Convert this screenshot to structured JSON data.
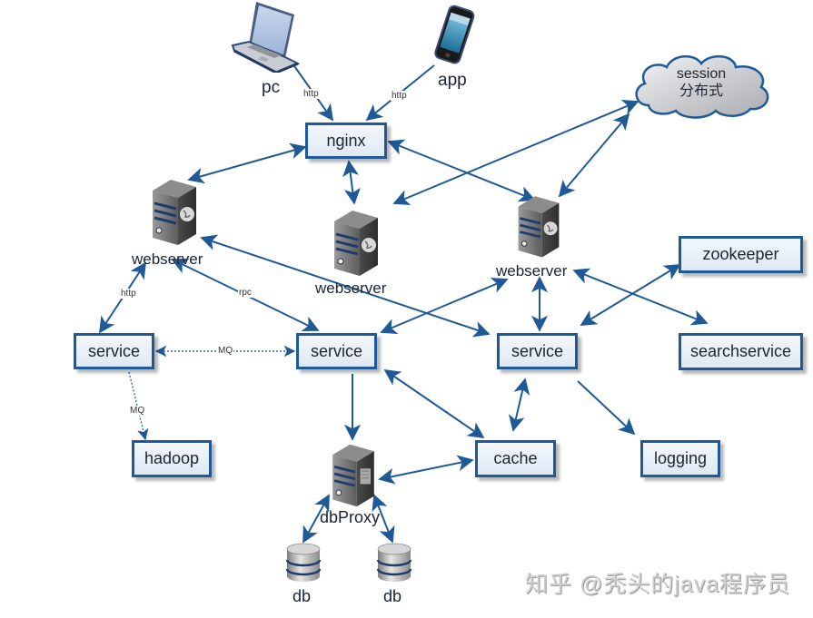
{
  "diagram": {
    "nodes": {
      "pc": {
        "label": "pc",
        "icon": "laptop-icon"
      },
      "app": {
        "label": "app",
        "icon": "smartphone-icon"
      },
      "session": {
        "label": "session",
        "sublabel": "分布式",
        "icon": "cloud-icon"
      },
      "nginx": {
        "label": "nginx"
      },
      "webserver_left": {
        "label": "webserver",
        "icon": "web-server-icon"
      },
      "webserver_mid": {
        "label": "webserver",
        "icon": "web-server-icon"
      },
      "webserver_right": {
        "label": "webserver",
        "icon": "web-server-icon"
      },
      "service_left": {
        "label": "service"
      },
      "service_mid": {
        "label": "service"
      },
      "service_right": {
        "label": "service"
      },
      "zookeeper": {
        "label": "zookeeper"
      },
      "searchservice": {
        "label": "searchservice"
      },
      "hadoop": {
        "label": "hadoop"
      },
      "cache": {
        "label": "cache"
      },
      "logging": {
        "label": "logging"
      },
      "dbproxy": {
        "label": "dbProxy",
        "icon": "proxy-server-icon"
      },
      "db_left": {
        "label": "db",
        "icon": "database-icon"
      },
      "db_right": {
        "label": "db",
        "icon": "database-icon"
      }
    },
    "edge_labels": {
      "pc_nginx": "http",
      "app_nginx": "http",
      "ws_service_http": "http",
      "ws_service_rpc": "rpc",
      "service_service_mq": "MQ",
      "service_hadoop_mq": "MQ"
    },
    "edges": [
      {
        "from": "pc",
        "to": "nginx",
        "label": "http",
        "direction": "forward"
      },
      {
        "from": "app",
        "to": "nginx",
        "label": "http",
        "direction": "forward"
      },
      {
        "from": "nginx",
        "to": "webserver_left",
        "direction": "both"
      },
      {
        "from": "nginx",
        "to": "webserver_mid",
        "direction": "both"
      },
      {
        "from": "nginx",
        "to": "webserver_right",
        "direction": "both"
      },
      {
        "from": "session",
        "to": "webserver_mid",
        "direction": "both"
      },
      {
        "from": "session",
        "to": "webserver_right",
        "direction": "both"
      },
      {
        "from": "webserver_left",
        "to": "service_left",
        "label": "http",
        "direction": "both"
      },
      {
        "from": "webserver_left",
        "to": "service_mid",
        "label": "rpc",
        "direction": "both"
      },
      {
        "from": "webserver_left",
        "to": "service_right",
        "direction": "both"
      },
      {
        "from": "webserver_right",
        "to": "service_mid",
        "direction": "both"
      },
      {
        "from": "webserver_right",
        "to": "service_right",
        "direction": "both"
      },
      {
        "from": "webserver_right",
        "to": "searchservice",
        "direction": "both"
      },
      {
        "from": "zookeeper",
        "to": "service_right",
        "direction": "both"
      },
      {
        "from": "service_left",
        "to": "service_mid",
        "label": "MQ",
        "direction": "both",
        "style": "dotted"
      },
      {
        "from": "service_left",
        "to": "hadoop",
        "label": "MQ",
        "direction": "forward",
        "style": "dotted"
      },
      {
        "from": "service_mid",
        "to": "dbproxy",
        "direction": "forward"
      },
      {
        "from": "service_mid",
        "to": "cache",
        "direction": "both"
      },
      {
        "from": "service_right",
        "to": "cache",
        "direction": "both"
      },
      {
        "from": "service_right",
        "to": "logging",
        "direction": "forward"
      },
      {
        "from": "cache",
        "to": "dbproxy",
        "direction": "both"
      },
      {
        "from": "dbproxy",
        "to": "db_left",
        "direction": "both"
      },
      {
        "from": "dbproxy",
        "to": "db_right",
        "direction": "both"
      }
    ],
    "colors": {
      "edge": "#1f5a97",
      "box_border": "#1f5a97",
      "box_fill": "#e6edf6",
      "cloud_border": "#1f5a97",
      "cloud_fill": "#d4d6da",
      "server_body": "#5a5a5a",
      "watermark": "#cfcfcf"
    }
  },
  "watermark": {
    "text": "知乎 @秃头的java程序员"
  }
}
